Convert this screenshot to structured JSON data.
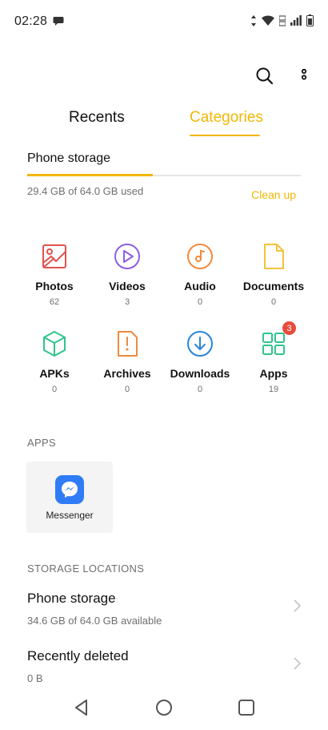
{
  "status_bar": {
    "time": "02:28"
  },
  "tabs": [
    {
      "label": "Recents",
      "active": false
    },
    {
      "label": "Categories",
      "active": true
    }
  ],
  "storage_summary": {
    "title": "Phone storage",
    "used_text": "29.4 GB of 64.0 GB used",
    "used_fraction": 0.46,
    "clean_up_label": "Clean up"
  },
  "categories": [
    {
      "label": "Photos",
      "count": "62",
      "icon": "photos-icon",
      "color": "#e0524f"
    },
    {
      "label": "Videos",
      "count": "3",
      "icon": "videos-icon",
      "color": "#8c5ee6"
    },
    {
      "label": "Audio",
      "count": "0",
      "icon": "audio-icon",
      "color": "#ef8a3d"
    },
    {
      "label": "Documents",
      "count": "0",
      "icon": "documents-icon",
      "color": "#f2c33b"
    },
    {
      "label": "APKs",
      "count": "0",
      "icon": "apks-icon",
      "color": "#2fc58b"
    },
    {
      "label": "Archives",
      "count": "0",
      "icon": "archives-icon",
      "color": "#ef8a3d"
    },
    {
      "label": "Downloads",
      "count": "0",
      "icon": "downloads-icon",
      "color": "#2b84d8"
    },
    {
      "label": "Apps",
      "count": "19",
      "icon": "apps-icon",
      "color": "#2fc58b",
      "badge": "3"
    }
  ],
  "apps_section": {
    "header": "APPS",
    "apps": [
      {
        "name": "Messenger",
        "icon": "messenger-icon",
        "color": "#2f7cf6"
      }
    ]
  },
  "storage_locations": {
    "header": "STORAGE LOCATIONS",
    "items": [
      {
        "title": "Phone storage",
        "subtitle": "34.6 GB of 64.0 GB available"
      },
      {
        "title": "Recently deleted",
        "subtitle": "0 B"
      }
    ]
  },
  "colors": {
    "accent": "#f2b705",
    "secondary_text": "#6f6f6f",
    "badge": "#e84b3c"
  }
}
